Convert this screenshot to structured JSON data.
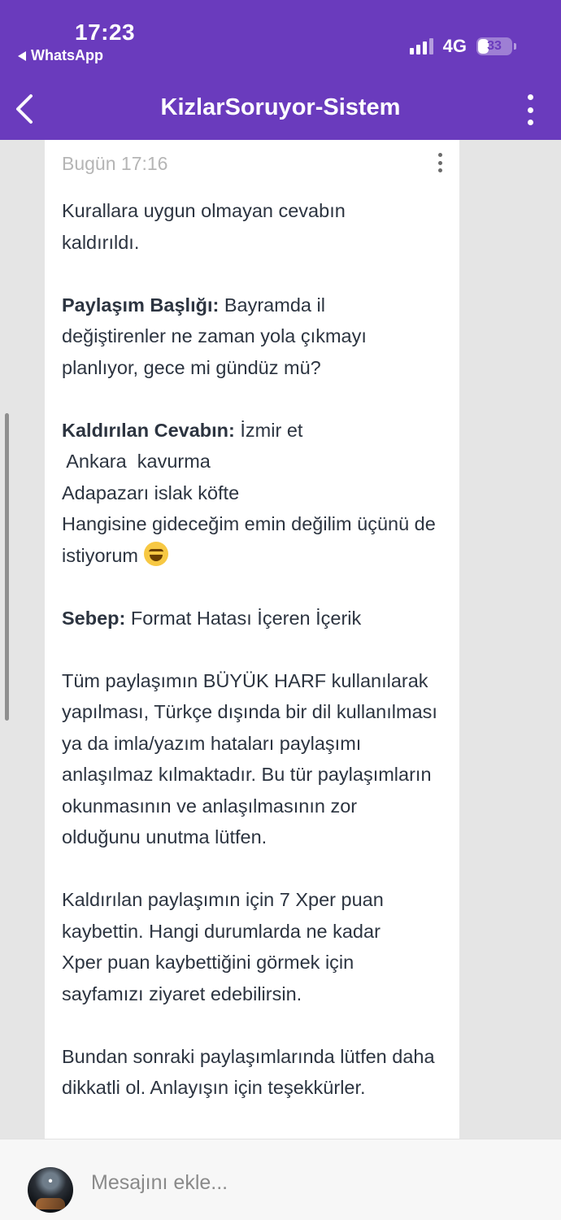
{
  "status_bar": {
    "time": "17:23",
    "back_app": "WhatsApp",
    "network": "4G",
    "battery": "33",
    "battery_level": 0.33
  },
  "header": {
    "title": "KizlarSoruyor-Sistem",
    "back_icon": "chevron-left-icon",
    "menu_icon": "more-vertical-icon"
  },
  "message": {
    "time": "Bugün 17:16",
    "intro": "Kurallara uygun olmayan cevabın kaldırıldı.",
    "title_label": "Paylaşım Başlığı:",
    "title_value": " Bayramda il değiştirenler ne zaman yola çıkmayı planlıyor, gece mi gündüz mü?",
    "answer_label": "Kaldırılan Cevabın:",
    "answer_line1": " İzmir et",
    "answer_line2": " Ankara  kavurma",
    "answer_line3": "Adapazarı islak köfte",
    "answer_line4": "Hangisine gideceğim emin değilim üçünü de istiyorum ",
    "reason_label": "Sebep:",
    "reason_value": " Format Hatası İçeren İçerik",
    "explanation": "Tüm paylaşımın BÜYÜK HARF kullanılarak yapılması, Türkçe dışında bir dil kullanılması ya da imla/yazım hataları paylaşımı anlaşılmaz kılmaktadır. Bu tür paylaşımların okunmasının ve anlaşılmasının zor olduğunu unutma lütfen.",
    "penalty": "Kaldırılan paylaşımın için 7 Xper puan kaybettin. Hangi durumlarda ne kadar Xper puan kaybettiğini görmek için  sayfamızı ziyaret edebilirsin.",
    "closing": "Bundan sonraki paylaşımlarında lütfen daha dikkatli ol. Anlayışın için teşekkürler."
  },
  "composer": {
    "placeholder": "Mesajını ekle..."
  }
}
